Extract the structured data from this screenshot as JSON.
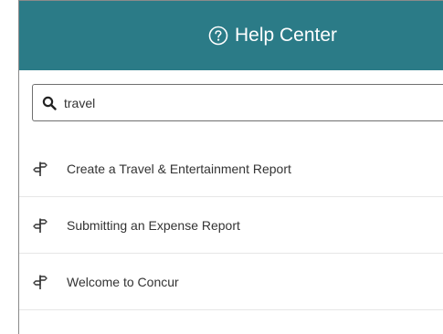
{
  "header": {
    "title": "Help Center",
    "icon": "question-circle-icon",
    "background": "#2b7b87"
  },
  "search": {
    "value": "travel",
    "icon": "search-icon"
  },
  "results": [
    {
      "label": "Create a Travel & Entertainment Report",
      "icon": "signpost-icon"
    },
    {
      "label": "Submitting an Expense Report",
      "icon": "signpost-icon"
    },
    {
      "label": "Welcome to Concur",
      "icon": "signpost-icon"
    }
  ]
}
